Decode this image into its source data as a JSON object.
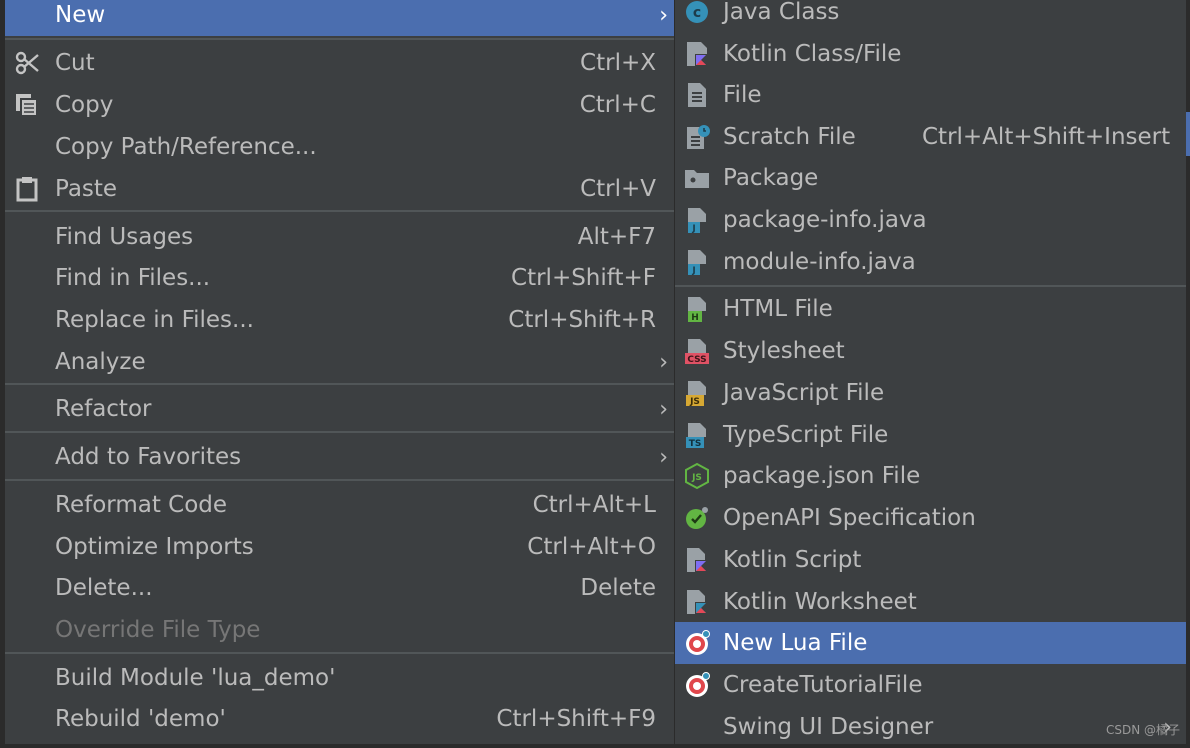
{
  "left_menu": {
    "items": [
      {
        "label": "New",
        "arrow": "›"
      },
      {
        "label": "Cut",
        "shortcut": "Ctrl+X",
        "icon": "scissors-icon"
      },
      {
        "label": "Copy",
        "shortcut": "Ctrl+C",
        "icon": "copy-icon"
      },
      {
        "label": "Copy Path/Reference..."
      },
      {
        "label": "Paste",
        "shortcut": "Ctrl+V",
        "icon": "clipboard-icon"
      },
      {
        "label": "Find Usages",
        "shortcut": "Alt+F7"
      },
      {
        "label": "Find in Files...",
        "shortcut": "Ctrl+Shift+F"
      },
      {
        "label": "Replace in Files...",
        "shortcut": "Ctrl+Shift+R"
      },
      {
        "label": "Analyze",
        "arrow": "›"
      },
      {
        "label": "Refactor",
        "arrow": "›"
      },
      {
        "label": "Add to Favorites",
        "arrow": "›"
      },
      {
        "label": "Reformat Code",
        "shortcut": "Ctrl+Alt+L"
      },
      {
        "label": "Optimize Imports",
        "shortcut": "Ctrl+Alt+O"
      },
      {
        "label": "Delete...",
        "shortcut": "Delete"
      },
      {
        "label": "Override File Type"
      },
      {
        "label": "Build Module 'lua_demo'"
      },
      {
        "label": "Rebuild 'demo'",
        "shortcut": "Ctrl+Shift+F9"
      }
    ]
  },
  "right_menu": {
    "items": [
      {
        "label": "Java Class",
        "icon": "java-class-icon"
      },
      {
        "label": "Kotlin Class/File",
        "icon": "kotlin-file-icon"
      },
      {
        "label": "File",
        "icon": "file-icon"
      },
      {
        "label": "Scratch File",
        "shortcut": "Ctrl+Alt+Shift+Insert",
        "icon": "scratch-file-icon"
      },
      {
        "label": "Package",
        "icon": "package-folder-icon"
      },
      {
        "label": "package-info.java",
        "icon": "java-file-icon"
      },
      {
        "label": "module-info.java",
        "icon": "java-file-icon"
      },
      {
        "label": "HTML File",
        "icon": "html-file-icon"
      },
      {
        "label": "Stylesheet",
        "icon": "css-file-icon"
      },
      {
        "label": "JavaScript File",
        "icon": "js-file-icon"
      },
      {
        "label": "TypeScript File",
        "icon": "ts-file-icon"
      },
      {
        "label": "package.json File",
        "icon": "nodejs-icon"
      },
      {
        "label": "OpenAPI Specification",
        "icon": "openapi-icon"
      },
      {
        "label": "Kotlin Script",
        "icon": "kotlin-script-icon"
      },
      {
        "label": "Kotlin Worksheet",
        "icon": "kotlin-worksheet-icon"
      },
      {
        "label": "New Lua File",
        "icon": "lua-icon"
      },
      {
        "label": "CreateTutorialFile",
        "icon": "lua-icon"
      },
      {
        "label": "Swing UI Designer",
        "arrow": "›"
      }
    ]
  },
  "watermark": "CSDN @橘子",
  "colors": {
    "menu_bg": "#3c3f41",
    "selection": "#4b6eaf",
    "text": "#bbbbbb",
    "disabled": "#767676",
    "separator": "#515658"
  }
}
